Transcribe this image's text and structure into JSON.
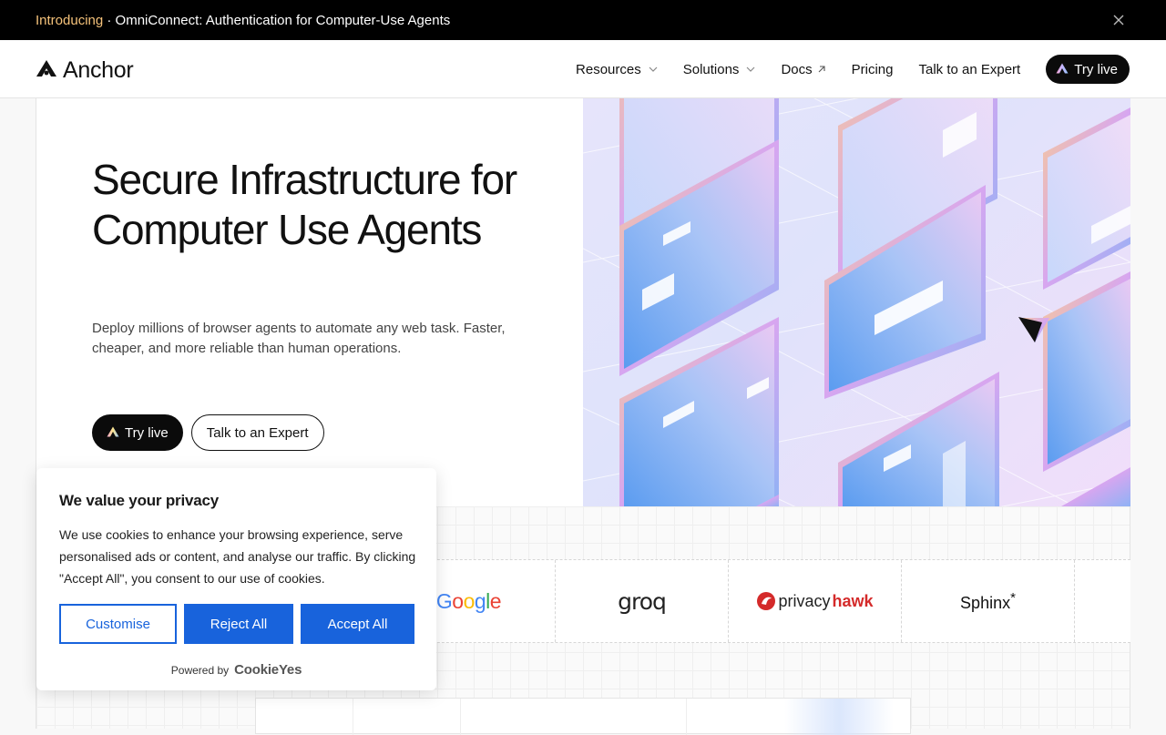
{
  "announcement": {
    "highlight": "Introducing",
    "text": " · OmniConnect: Authentication for Computer-Use Agents",
    "highlight_color": "#f5c27a",
    "close_icon": "close-icon"
  },
  "nav": {
    "brand": "Anchor",
    "items": [
      {
        "label": "Resources",
        "icon": "chevron-down-icon"
      },
      {
        "label": "Solutions",
        "icon": "chevron-down-icon"
      },
      {
        "label": "Docs",
        "icon": "external-link-icon"
      },
      {
        "label": "Pricing"
      },
      {
        "label": "Talk to an Expert"
      }
    ],
    "cta": "Try live"
  },
  "hero": {
    "title": "Secure Infrastructure for Computer Use Agents",
    "subtitle": "Deploy millions of browser agents to automate any web task. Faster, cheaper, and more reliable than human operations.",
    "primary_cta": "Try live",
    "secondary_cta": "Talk to an Expert"
  },
  "logos": {
    "google": [
      "G",
      "o",
      "o",
      "g",
      "l",
      "e"
    ],
    "google_colors": [
      "#4285f4",
      "#ea4335",
      "#fbbc05",
      "#4285f4",
      "#34a853",
      "#ea4335"
    ],
    "groq": "groq",
    "privacyhawk_a": "privacy",
    "privacyhawk_b": "hawk",
    "sphinx": "Sphinx",
    "sphinx_mark": "*"
  },
  "cookie": {
    "title": "We value your privacy",
    "body": "We use cookies to enhance your browsing experience, serve personalised ads or content, and analyse our traffic. By clicking \"Accept All\", you consent to our use of cookies.",
    "customise": "Customise",
    "reject": "Reject All",
    "accept": "Accept All",
    "powered_by": "Powered by",
    "provider": "CookieYes",
    "accent": "#1863dc"
  }
}
